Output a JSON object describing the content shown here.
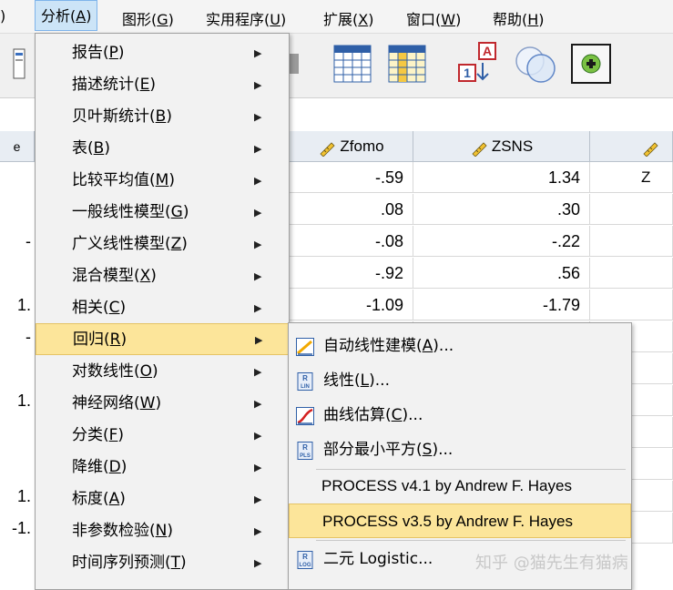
{
  "menubar": {
    "items": [
      {
        "label": "分析",
        "key": "A"
      },
      {
        "label": "图形",
        "key": "G"
      },
      {
        "label": "实用程序",
        "key": "U"
      },
      {
        "label": "扩展",
        "key": "X"
      },
      {
        "label": "窗口",
        "key": "W"
      },
      {
        "label": "帮助",
        "key": "H"
      }
    ],
    "left_fragment": ")"
  },
  "grid": {
    "columns": [
      {
        "name": "Zfomo"
      },
      {
        "name": "ZSNS"
      },
      {
        "name": "Z"
      }
    ],
    "rows": [
      {
        "zfomo": "-.59",
        "zsns": "1.34",
        "left": ""
      },
      {
        "zfomo": ".08",
        "zsns": ".30",
        "left": ""
      },
      {
        "zfomo": "-.08",
        "zsns": "-.22",
        "left": "-"
      },
      {
        "zfomo": "-.92",
        "zsns": ".56",
        "left": ""
      },
      {
        "zfomo": "-1.09",
        "zsns": "-1.79",
        "left": "1."
      },
      {
        "zfomo": "",
        "zsns": "",
        "left": "-"
      },
      {
        "zfomo": "",
        "zsns": "",
        "left": ""
      },
      {
        "zfomo": "",
        "zsns": "",
        "left": "1."
      },
      {
        "zfomo": "",
        "zsns": "",
        "left": ""
      },
      {
        "zfomo": "",
        "zsns": "",
        "left": ""
      },
      {
        "zfomo": "",
        "zsns": "",
        "left": "1."
      },
      {
        "zfomo": "",
        "zsns": "",
        "left": "-1."
      }
    ]
  },
  "analyze_menu": {
    "items": [
      {
        "label": "报告",
        "key": "P"
      },
      {
        "label": "描述统计",
        "key": "E"
      },
      {
        "label": "贝叶斯统计",
        "key": "B"
      },
      {
        "label": "表",
        "key": "B"
      },
      {
        "label": "比较平均值",
        "key": "M"
      },
      {
        "label": "一般线性模型",
        "key": "G"
      },
      {
        "label": "广义线性模型",
        "key": "Z"
      },
      {
        "label": "混合模型",
        "key": "X"
      },
      {
        "label": "相关",
        "key": "C"
      },
      {
        "label": "回归",
        "key": "R"
      },
      {
        "label": "对数线性",
        "key": "O"
      },
      {
        "label": "神经网络",
        "key": "W"
      },
      {
        "label": "分类",
        "key": "F"
      },
      {
        "label": "降维",
        "key": "D"
      },
      {
        "label": "标度",
        "key": "A"
      },
      {
        "label": "非参数检验",
        "key": "N"
      },
      {
        "label": "时间序列预测",
        "key": "T"
      }
    ],
    "active_index": 9
  },
  "regression_submenu": {
    "items": [
      {
        "label": "自动线性建模",
        "key": "A",
        "suffix": "...",
        "icon": "auto-linear-icon"
      },
      {
        "label": "线性",
        "key": "L",
        "suffix": "...",
        "icon": "linear-icon"
      },
      {
        "label": "曲线估算",
        "key": "C",
        "suffix": "...",
        "icon": "curve-icon"
      },
      {
        "label": "部分最小平方",
        "key": "S",
        "suffix": "...",
        "icon": "pls-icon"
      },
      {
        "label": "PROCESS v4.1 by Andrew F. Hayes",
        "key": "",
        "suffix": "",
        "icon": ""
      },
      {
        "label": "PROCESS v3.5 by Andrew F. Hayes",
        "key": "",
        "suffix": "",
        "icon": ""
      },
      {
        "label": "二元 Logistic",
        "key": "",
        "suffix": "...",
        "icon": "logistic-icon"
      }
    ],
    "active_index": 5
  },
  "watermark": "知乎 @猫先生有猫病",
  "colors": {
    "highlight": "#fce59a",
    "menubar_open": "#cce4f7",
    "column_header": "#e8edf3"
  }
}
